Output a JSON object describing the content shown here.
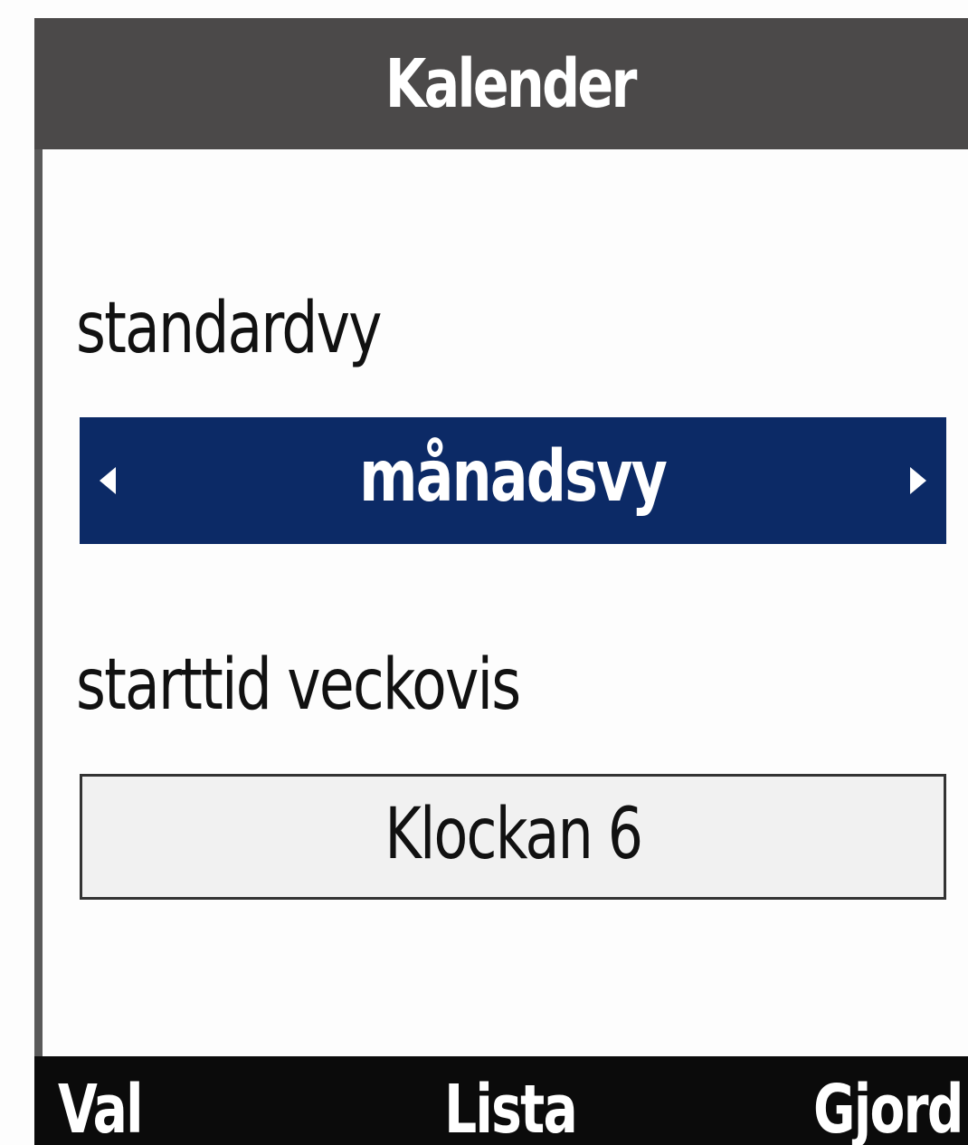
{
  "header": {
    "title": "Kalender"
  },
  "settings": {
    "default_view": {
      "label": "standardvy",
      "value": "månadsvy"
    },
    "weekly_start_time": {
      "label": "starttid veckovis",
      "value": "Klockan 6"
    }
  },
  "softkeys": {
    "left": "Val",
    "center": "Lista",
    "right": "Gjord"
  },
  "colors": {
    "title_bar": "#4b4949",
    "selection": "#0c2a66",
    "softkey_bar": "#0b0b0b"
  },
  "icons": {
    "selector_left": "arrow-left-icon",
    "selector_right": "arrow-right-icon"
  }
}
